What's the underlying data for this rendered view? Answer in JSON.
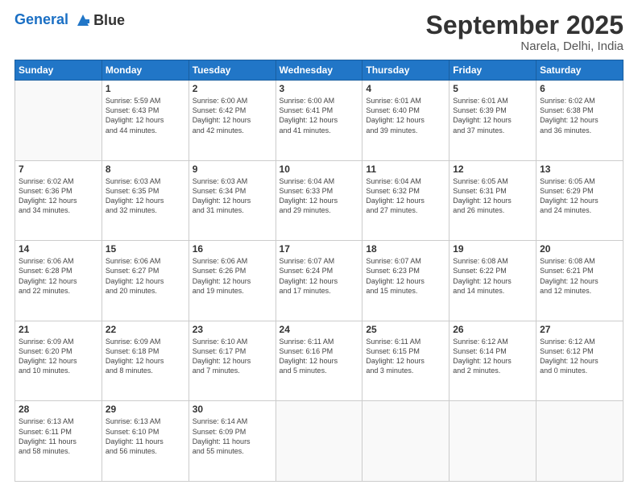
{
  "logo": {
    "line1": "General",
    "line2": "Blue"
  },
  "header": {
    "month": "September 2025",
    "location": "Narela, Delhi, India"
  },
  "days_of_week": [
    "Sunday",
    "Monday",
    "Tuesday",
    "Wednesday",
    "Thursday",
    "Friday",
    "Saturday"
  ],
  "weeks": [
    [
      {
        "day": "",
        "info": ""
      },
      {
        "day": "1",
        "info": "Sunrise: 5:59 AM\nSunset: 6:43 PM\nDaylight: 12 hours\nand 44 minutes."
      },
      {
        "day": "2",
        "info": "Sunrise: 6:00 AM\nSunset: 6:42 PM\nDaylight: 12 hours\nand 42 minutes."
      },
      {
        "day": "3",
        "info": "Sunrise: 6:00 AM\nSunset: 6:41 PM\nDaylight: 12 hours\nand 41 minutes."
      },
      {
        "day": "4",
        "info": "Sunrise: 6:01 AM\nSunset: 6:40 PM\nDaylight: 12 hours\nand 39 minutes."
      },
      {
        "day": "5",
        "info": "Sunrise: 6:01 AM\nSunset: 6:39 PM\nDaylight: 12 hours\nand 37 minutes."
      },
      {
        "day": "6",
        "info": "Sunrise: 6:02 AM\nSunset: 6:38 PM\nDaylight: 12 hours\nand 36 minutes."
      }
    ],
    [
      {
        "day": "7",
        "info": "Sunrise: 6:02 AM\nSunset: 6:36 PM\nDaylight: 12 hours\nand 34 minutes."
      },
      {
        "day": "8",
        "info": "Sunrise: 6:03 AM\nSunset: 6:35 PM\nDaylight: 12 hours\nand 32 minutes."
      },
      {
        "day": "9",
        "info": "Sunrise: 6:03 AM\nSunset: 6:34 PM\nDaylight: 12 hours\nand 31 minutes."
      },
      {
        "day": "10",
        "info": "Sunrise: 6:04 AM\nSunset: 6:33 PM\nDaylight: 12 hours\nand 29 minutes."
      },
      {
        "day": "11",
        "info": "Sunrise: 6:04 AM\nSunset: 6:32 PM\nDaylight: 12 hours\nand 27 minutes."
      },
      {
        "day": "12",
        "info": "Sunrise: 6:05 AM\nSunset: 6:31 PM\nDaylight: 12 hours\nand 26 minutes."
      },
      {
        "day": "13",
        "info": "Sunrise: 6:05 AM\nSunset: 6:29 PM\nDaylight: 12 hours\nand 24 minutes."
      }
    ],
    [
      {
        "day": "14",
        "info": "Sunrise: 6:06 AM\nSunset: 6:28 PM\nDaylight: 12 hours\nand 22 minutes."
      },
      {
        "day": "15",
        "info": "Sunrise: 6:06 AM\nSunset: 6:27 PM\nDaylight: 12 hours\nand 20 minutes."
      },
      {
        "day": "16",
        "info": "Sunrise: 6:06 AM\nSunset: 6:26 PM\nDaylight: 12 hours\nand 19 minutes."
      },
      {
        "day": "17",
        "info": "Sunrise: 6:07 AM\nSunset: 6:24 PM\nDaylight: 12 hours\nand 17 minutes."
      },
      {
        "day": "18",
        "info": "Sunrise: 6:07 AM\nSunset: 6:23 PM\nDaylight: 12 hours\nand 15 minutes."
      },
      {
        "day": "19",
        "info": "Sunrise: 6:08 AM\nSunset: 6:22 PM\nDaylight: 12 hours\nand 14 minutes."
      },
      {
        "day": "20",
        "info": "Sunrise: 6:08 AM\nSunset: 6:21 PM\nDaylight: 12 hours\nand 12 minutes."
      }
    ],
    [
      {
        "day": "21",
        "info": "Sunrise: 6:09 AM\nSunset: 6:20 PM\nDaylight: 12 hours\nand 10 minutes."
      },
      {
        "day": "22",
        "info": "Sunrise: 6:09 AM\nSunset: 6:18 PM\nDaylight: 12 hours\nand 8 minutes."
      },
      {
        "day": "23",
        "info": "Sunrise: 6:10 AM\nSunset: 6:17 PM\nDaylight: 12 hours\nand 7 minutes."
      },
      {
        "day": "24",
        "info": "Sunrise: 6:11 AM\nSunset: 6:16 PM\nDaylight: 12 hours\nand 5 minutes."
      },
      {
        "day": "25",
        "info": "Sunrise: 6:11 AM\nSunset: 6:15 PM\nDaylight: 12 hours\nand 3 minutes."
      },
      {
        "day": "26",
        "info": "Sunrise: 6:12 AM\nSunset: 6:14 PM\nDaylight: 12 hours\nand 2 minutes."
      },
      {
        "day": "27",
        "info": "Sunrise: 6:12 AM\nSunset: 6:12 PM\nDaylight: 12 hours\nand 0 minutes."
      }
    ],
    [
      {
        "day": "28",
        "info": "Sunrise: 6:13 AM\nSunset: 6:11 PM\nDaylight: 11 hours\nand 58 minutes."
      },
      {
        "day": "29",
        "info": "Sunrise: 6:13 AM\nSunset: 6:10 PM\nDaylight: 11 hours\nand 56 minutes."
      },
      {
        "day": "30",
        "info": "Sunrise: 6:14 AM\nSunset: 6:09 PM\nDaylight: 11 hours\nand 55 minutes."
      },
      {
        "day": "",
        "info": ""
      },
      {
        "day": "",
        "info": ""
      },
      {
        "day": "",
        "info": ""
      },
      {
        "day": "",
        "info": ""
      }
    ]
  ]
}
